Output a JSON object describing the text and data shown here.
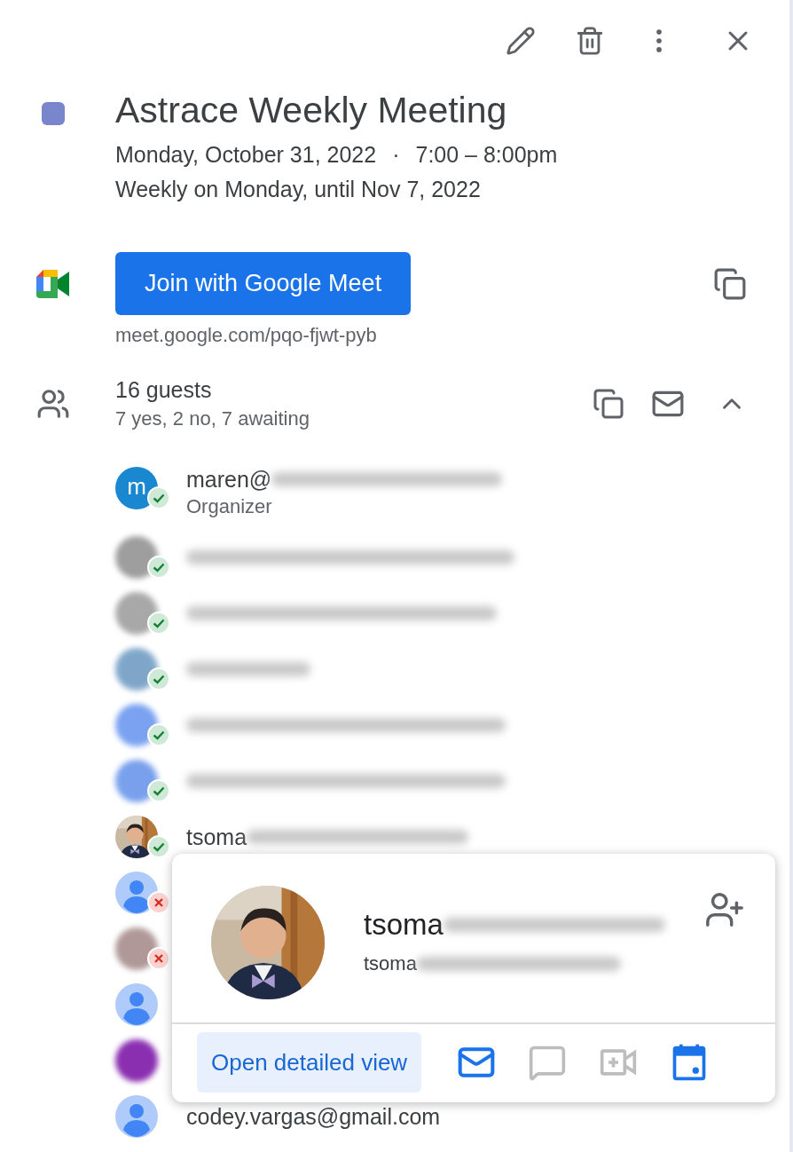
{
  "event": {
    "title": "Astrace Weekly Meeting",
    "color": "#7986cb",
    "date": "Monday, October 31, 2022",
    "separator": "·",
    "time": "7:00 – 8:00pm",
    "recurrence": "Weekly on Monday, until Nov 7, 2022"
  },
  "meet": {
    "button": "Join with Google Meet",
    "link": "meet.google.com/pqo-fjwt-pyb"
  },
  "guests": {
    "count": "16 guests",
    "summary": "7 yes, 2 no, 7 awaiting",
    "expanded": true,
    "list": [
      {
        "kind": "letter",
        "initial": "m",
        "name": "maren@",
        "role": "Organizer",
        "accepted": true,
        "declined": false,
        "redacted": true
      },
      {
        "kind": "blurred",
        "color": "#9e9e9e",
        "accepted": true,
        "declined": false,
        "redacted": true
      },
      {
        "kind": "blurred",
        "color": "#a8a8a8",
        "accepted": true,
        "declined": false,
        "redacted": true
      },
      {
        "kind": "blurred",
        "color": "#7fa6c9",
        "accepted": true,
        "declined": false,
        "redacted": true
      },
      {
        "kind": "blurred",
        "color": "#7aa2f0",
        "accepted": true,
        "declined": false,
        "redacted": true
      },
      {
        "kind": "blurred",
        "color": "#78a0ec",
        "accepted": true,
        "declined": false,
        "redacted": true
      },
      {
        "name": "tsoma",
        "accepted": true,
        "declined": false,
        "redacted": true
      },
      {
        "kind": "default",
        "accepted": false,
        "declined": true
      },
      {
        "kind": "blurred",
        "color": "#b09898",
        "accepted": false,
        "declined": true
      },
      {
        "kind": "default",
        "accepted": false,
        "declined": false
      },
      {
        "kind": "blurred",
        "color": "#8a2fb0",
        "accepted": false,
        "declined": false
      },
      {
        "kind": "default",
        "name": "codey.vargas@gmail.com",
        "accepted": false,
        "declined": false
      }
    ]
  },
  "popup": {
    "name": "tsoma",
    "email": "tsoma",
    "button": "Open detailed view",
    "actions": [
      {
        "kind": "mail",
        "disabled": false
      },
      {
        "kind": "chat",
        "disabled": true
      },
      {
        "kind": "video",
        "disabled": true
      },
      {
        "kind": "calendar",
        "disabled": false
      }
    ]
  }
}
